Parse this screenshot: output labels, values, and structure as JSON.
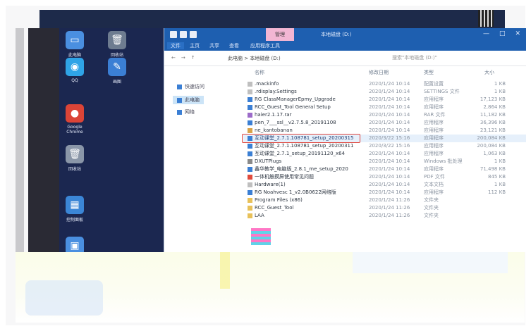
{
  "desktop": {
    "icons": [
      {
        "label": "此电脑",
        "glyph": "▭",
        "color": "#4a8fe0"
      },
      {
        "label": "回收站",
        "glyph": "🗑",
        "color": "#6e7c90"
      },
      {
        "label": "QQ",
        "glyph": "◉",
        "color": "#2fa4e7"
      },
      {
        "label": "画图",
        "glyph": "✎",
        "color": "#3b7fd4"
      },
      {
        "label": "Google Chrome",
        "glyph": "●",
        "color": "#db4437"
      },
      {
        "label": "回收站",
        "glyph": "🗑",
        "color": "#8a96a8"
      },
      {
        "label": "控制面板",
        "glyph": "▦",
        "color": "#3b86d6"
      },
      {
        "label": "",
        "glyph": "▣",
        "color": "#4a8fe0"
      }
    ]
  },
  "explorer": {
    "title": "本地磁盘 (D:)",
    "manage_tab": "管理",
    "window_controls": [
      "—",
      "□",
      "✕"
    ],
    "ribbon_tabs": [
      "文件",
      "主页",
      "共享",
      "查看",
      "应用程序工具"
    ],
    "path": "此电脑 > 本地磁盘 (D:)",
    "search_placeholder": "搜索\"本地磁盘 (D:)\"",
    "nav_items": [
      {
        "label": "快速访问",
        "selected": false
      },
      {
        "label": "此电脑",
        "selected": true
      },
      {
        "label": "网络",
        "selected": false
      }
    ],
    "columns": {
      "name": "名称",
      "date": "修改日期",
      "type": "类型",
      "size": "大小"
    },
    "files": [
      {
        "name": ".mackinfo",
        "date": "2020/1/24 10:14",
        "type": "配置设置",
        "size": "1 KB",
        "color": "#bfbfbf",
        "highlight": false
      },
      {
        "name": ".rdisplay.Settings",
        "date": "2020/1/24 10:14",
        "type": "SETTINGS 文件",
        "size": "1 KB",
        "color": "#bfbfbf",
        "highlight": false
      },
      {
        "name": "RG ClassManagerEpmy_Upgrade",
        "date": "2020/1/24 10:14",
        "type": "应用程序",
        "size": "17,123 KB",
        "color": "#3b7fd4",
        "highlight": false
      },
      {
        "name": "RCC_Guest_Tool General Setup",
        "date": "2020/1/24 10:14",
        "type": "应用程序",
        "size": "2,864 KB",
        "color": "#3b7fd4",
        "highlight": false
      },
      {
        "name": "haier2.1.17.rar",
        "date": "2020/1/24 10:14",
        "type": "RAR 文件",
        "size": "11,182 KB",
        "color": "#9c6bc9",
        "highlight": false
      },
      {
        "name": "pen_7___ssl__v2.7.5.8_20191108",
        "date": "2020/1/24 10:14",
        "type": "应用程序",
        "size": "36,396 KB",
        "color": "#3b7fd4",
        "highlight": false
      },
      {
        "name": "ne_kantobanan",
        "date": "2020/1/24 10:14",
        "type": "应用程序",
        "size": "23,121 KB",
        "color": "#d8a34a",
        "highlight": false
      },
      {
        "name": "互动课堂_2.7.1.108781_setup_20200315",
        "date": "2020/3/22 15:16",
        "type": "应用程序",
        "size": "200,084 KB",
        "color": "#3b7fd4",
        "highlight": true
      },
      {
        "name": "互动课堂_2.7.1.108781_setup_20200311",
        "date": "2020/3/22 15:16",
        "type": "应用程序",
        "size": "200,084 KB",
        "color": "#3b7fd4",
        "highlight": false
      },
      {
        "name": "互动课堂_2.7.1_setup_20191120_x64",
        "date": "2020/1/24 10:14",
        "type": "应用程序",
        "size": "1,063 KB",
        "color": "#3b7fd4",
        "highlight": false
      },
      {
        "name": "DXUTPlugs",
        "date": "2020/1/24 10:14",
        "type": "Windows 批处理",
        "size": "1 KB",
        "color": "#8a8a8a",
        "highlight": false
      },
      {
        "name": "鑫华教学_电脑版_2.8.1_me_setup_2020",
        "date": "2020/1/24 10:14",
        "type": "应用程序",
        "size": "71,498 KB",
        "color": "#3b7fd4",
        "highlight": false
      },
      {
        "name": "一体机触摸屏使用常见问题",
        "date": "2020/1/24 10:14",
        "type": "PDF 文件",
        "size": "845 KB",
        "color": "#e04a3c",
        "highlight": false
      },
      {
        "name": "Hardware(1)",
        "date": "2020/1/24 10:14",
        "type": "文本文档",
        "size": "1 KB",
        "color": "#bfbfbf",
        "highlight": false
      },
      {
        "name": "RG Noahvesc 1_v2.0B0622网络版",
        "date": "2020/1/24 10:14",
        "type": "应用程序",
        "size": "112 KB",
        "color": "#3b7fd4",
        "highlight": false
      },
      {
        "name": "Program Files (x86)",
        "date": "2020/1/24 11:26",
        "type": "文件夹",
        "size": "",
        "color": "#e8c15a",
        "highlight": false
      },
      {
        "name": "RCC_Guest_Tool",
        "date": "2020/1/24 11:26",
        "type": "文件夹",
        "size": "",
        "color": "#e8c15a",
        "highlight": false
      },
      {
        "name": "LAA",
        "date": "2020/1/24 11:26",
        "type": "文件夹",
        "size": "",
        "color": "#e8c15a",
        "highlight": false
      }
    ]
  }
}
